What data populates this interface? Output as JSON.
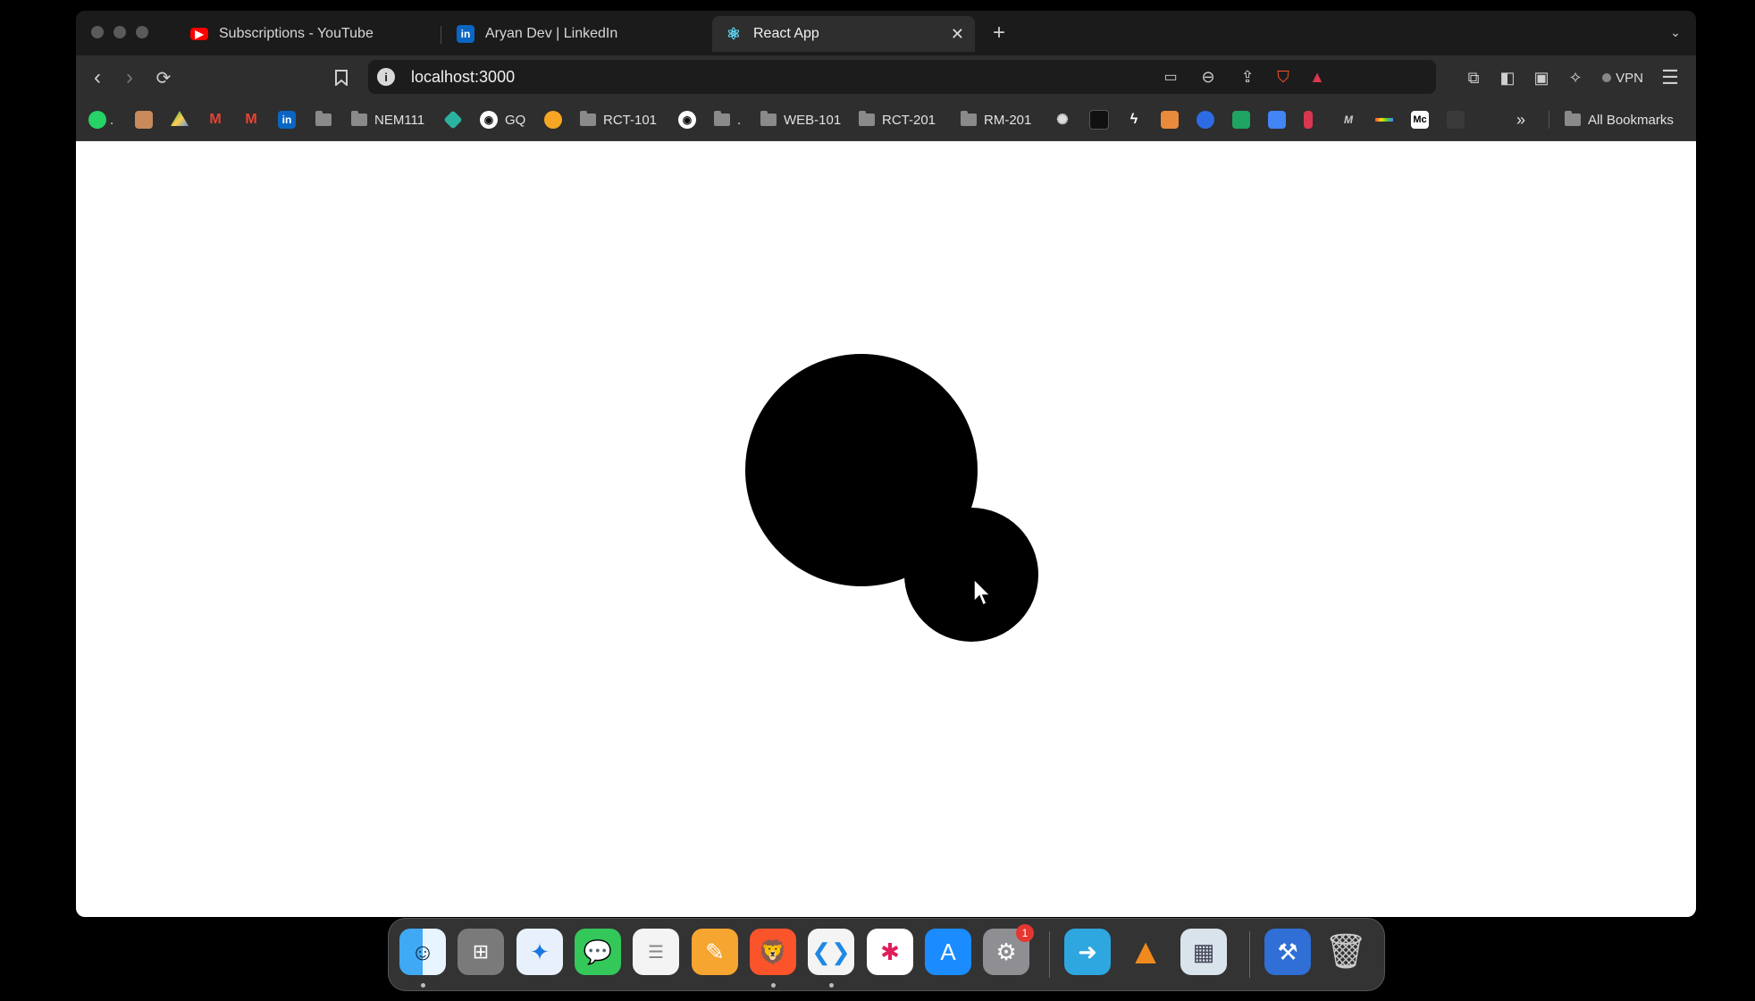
{
  "tabs": [
    {
      "label": "Subscriptions - YouTube",
      "icon": "youtube-icon"
    },
    {
      "label": "Aryan Dev | LinkedIn",
      "icon": "linkedin-icon"
    },
    {
      "label": "React App",
      "icon": "react-icon",
      "active": true
    }
  ],
  "toolbar": {
    "url": "localhost:3000",
    "vpn_label": "VPN"
  },
  "bookmarks": {
    "items": [
      "NEM111",
      "GQ",
      "RCT-101",
      ".",
      "WEB-101",
      "RCT-201",
      "RM-201",
      "."
    ],
    "all_bookmarks": "All Bookmarks"
  },
  "page": {
    "circle_color": "#000000",
    "background": "#ffffff"
  },
  "dock": {
    "apps": [
      "finder-icon",
      "launchpad-icon",
      "safari-icon",
      "messages-icon",
      "reminders-icon",
      "pages-icon",
      "brave-icon",
      "vscode-icon",
      "slack-icon",
      "app-store-icon",
      "system-settings-icon",
      "transfer-icon",
      "vlc-icon",
      "preview-icon",
      "xcode-icon",
      "trash-icon"
    ],
    "settings_badge": "1"
  }
}
